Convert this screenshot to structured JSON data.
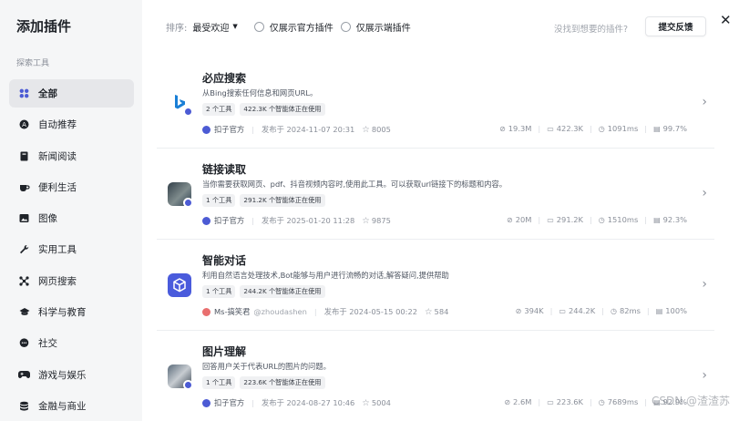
{
  "sidebar": {
    "title": "添加插件",
    "section": "探索工具",
    "items": [
      {
        "label": "全部",
        "icon": "grid-icon",
        "active": true
      },
      {
        "label": "自动推荐",
        "icon": "sparkle-circle-icon"
      },
      {
        "label": "新闻阅读",
        "icon": "book-icon"
      },
      {
        "label": "便利生活",
        "icon": "coffee-icon"
      },
      {
        "label": "图像",
        "icon": "image-icon"
      },
      {
        "label": "实用工具",
        "icon": "wrench-icon"
      },
      {
        "label": "网页搜索",
        "icon": "network-icon"
      },
      {
        "label": "科学与教育",
        "icon": "graduation-cap-icon"
      },
      {
        "label": "社交",
        "icon": "chat-bubble-icon"
      },
      {
        "label": "游戏与娱乐",
        "icon": "gamepad-icon"
      },
      {
        "label": "金融与商业",
        "icon": "coins-icon"
      }
    ]
  },
  "toolbar": {
    "sort_label": "排序:",
    "sort_value": "最受欢迎",
    "filter_official": "仅展示官方插件",
    "filter_client": "仅展示端插件",
    "hint": "没找到想要的插件?",
    "feedback": "提交反馈"
  },
  "plugins": [
    {
      "name": "必应搜索",
      "desc": "从Bing搜索任何信息和网页URL。",
      "tags": [
        "2 个工具",
        "422.3K 个智能体正在使用"
      ],
      "author": "扣子官方",
      "published": "发布于 2024-11-07 20:31",
      "stars": "8005",
      "stats": [
        "19.3M",
        "422.3K",
        "1091ms",
        "99.7%"
      ]
    },
    {
      "name": "链接读取",
      "desc": "当你需要获取网页、pdf、抖音视频内容时,使用此工具。可以获取url链接下的标题和内容。",
      "tags": [
        "1 个工具",
        "291.2K 个智能体正在使用"
      ],
      "author": "扣子官方",
      "published": "发布于 2025-01-20 11:28",
      "stars": "9875",
      "stats": [
        "20M",
        "291.2K",
        "1510ms",
        "92.3%"
      ]
    },
    {
      "name": "智能对话",
      "desc": "利用自然语言处理技术,Bot能够与用户进行流畅的对话,解答疑问,提供帮助",
      "tags": [
        "1 个工具",
        "244.2K 个智能体正在使用"
      ],
      "author": "Ms-搞笑君",
      "author_handle": "@zhoudashen",
      "published": "发布于 2024-05-15 00:22",
      "stars": "584",
      "stats": [
        "394K",
        "244.2K",
        "82ms",
        "100%"
      ]
    },
    {
      "name": "图片理解",
      "desc": "回答用户关于代表URL的图片的问题。",
      "tags": [
        "1 个工具",
        "223.6K 个智能体正在使用"
      ],
      "author": "扣子官方",
      "published": "发布于 2024-08-27 10:46",
      "stars": "5004",
      "stats": [
        "2.6M",
        "223.6K",
        "7689ms",
        "92.9%"
      ]
    }
  ],
  "watermark": "CSDN @渣渣苏"
}
